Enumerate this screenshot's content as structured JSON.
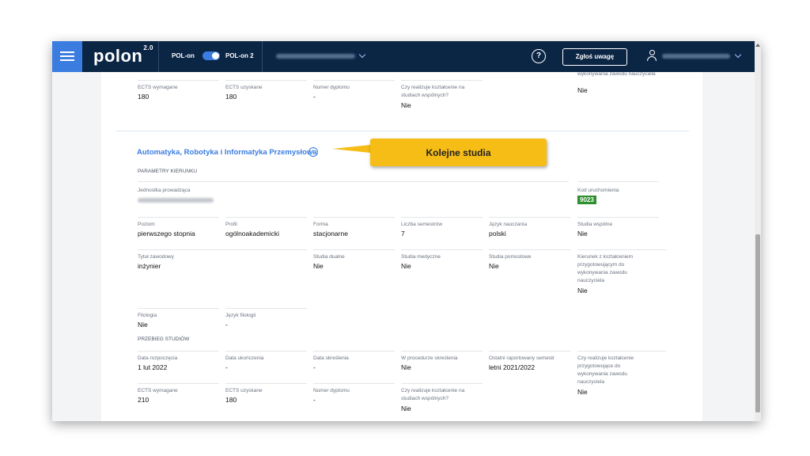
{
  "header": {
    "logo": "polon",
    "logo_version": "2.0",
    "toggle_left_label": "POL-on",
    "toggle_right_label": "POL-on 2",
    "help_label": "?",
    "report_button": "Zgłoś uwagę"
  },
  "top_block": {
    "row_a": [
      {
        "label": "ECTS wymagane",
        "value": "180"
      },
      {
        "label": "ECTS uzyskane",
        "value": "180"
      },
      {
        "label": "Numer dyplomu",
        "value": "-"
      },
      {
        "label": "Czy realizuje kształcenie na studiach wspólnych?",
        "value": "Nie"
      }
    ],
    "teacher_prep_label_tail": "wykonywania zawodu nauczyciela",
    "teacher_prep_value": "Nie"
  },
  "callout": {
    "text": "Kolejne studia"
  },
  "study": {
    "title": "Automatyka, Robotyka i Informatyka Przemysłowa",
    "info_icon_glyph": "i",
    "params_heading": "PARAMETRY KIERUNKU",
    "unit_label": "Jednostka prowadząca",
    "launch_code_label": "Kod uruchomienia",
    "launch_code": "9023",
    "row1": [
      {
        "label": "Poziom",
        "value": "pierwszego stopnia"
      },
      {
        "label": "Profil",
        "value": "ogólnoakademicki"
      },
      {
        "label": "Forma",
        "value": "stacjonarne"
      },
      {
        "label": "Liczba semestrów",
        "value": "7"
      },
      {
        "label": "Język nauczania",
        "value": "polski"
      },
      {
        "label": "Studia wspólne",
        "value": "Nie"
      }
    ],
    "row2": [
      {
        "label": "Tytuł zawodowy",
        "value": "inżynier"
      },
      {
        "label": "Studia dualne",
        "value": "Nie"
      },
      {
        "label": "Studia medyczne",
        "value": "Nie"
      },
      {
        "label": "Studia pomostowe",
        "value": "Nie"
      },
      {
        "label": "Kierunek z kształceniem przygotowującym do wykonywania zawodu nauczyciela",
        "value": "Nie"
      }
    ],
    "row3": [
      {
        "label": "Filologia",
        "value": "Nie"
      },
      {
        "label": "Język filologii",
        "value": "-"
      }
    ],
    "history_heading": "PRZEBIEG STUDIÓW",
    "row4": [
      {
        "label": "Data rozpoczęcia",
        "value": "1 lut 2022"
      },
      {
        "label": "Data ukończenia",
        "value": "-"
      },
      {
        "label": "Data skreślenia",
        "value": "-"
      },
      {
        "label": "W procedurze skreślenia",
        "value": "Nie"
      },
      {
        "label": "Ostatni raportowany semestr",
        "value": "letni 2021/2022"
      },
      {
        "label": "Czy realizuje kształcenie przygotowujące do wykonywania zawodu nauczyciela",
        "value": "Nie"
      }
    ],
    "row5": [
      {
        "label": "ECTS wymagane",
        "value": "210"
      },
      {
        "label": "ECTS uzyskane",
        "value": "180"
      },
      {
        "label": "Numer dyplomu",
        "value": "-"
      },
      {
        "label": "Czy realizuje kształcenie na studiach wspólnych?",
        "value": "Nie"
      }
    ]
  },
  "colors": {
    "header_bg": "#0b2545",
    "accent": "#3a7ce0",
    "callout": "#f6bd16",
    "code_badge": "#2f8f2f"
  }
}
